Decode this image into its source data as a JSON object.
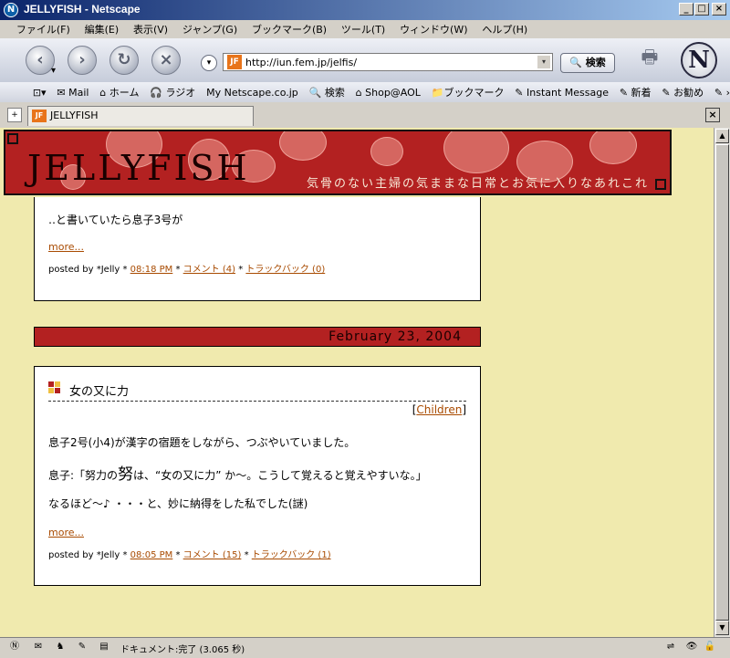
{
  "window": {
    "title": "JELLYFISH - Netscape",
    "app_icon": "netscape-icon",
    "min": "_",
    "max": "□",
    "close": "×"
  },
  "menu": [
    "ファイル(F)",
    "編集(E)",
    "表示(V)",
    "ジャンプ(G)",
    "ブックマーク(B)",
    "ツール(T)",
    "ウィンドウ(W)",
    "ヘルプ(H)"
  ],
  "nav": {
    "back": "‹",
    "forward": "›",
    "reload": "↻",
    "stop": "×",
    "dropdown": "▾",
    "url": "http://iun.fem.jp/jelfis/",
    "search_label": "🔍 検索",
    "logo": "N"
  },
  "personal_toolbar": [
    "⊡▾",
    "✉ Mail",
    "⌂ ホーム",
    "🎧 ラジオ",
    "My Netscape.co.jp",
    "🔍 検索",
    "⌂ Shop@AOL",
    "📁ブックマーク",
    "✎ Instant Message",
    "✎ 新着",
    "✎ お勧め",
    "✎ ›"
  ],
  "tab": {
    "favicon": "JF",
    "label": "JELLYFISH",
    "close": "×"
  },
  "banner": {
    "title": "JELLYFISH",
    "tagline": "気骨のない主婦の気ままな日常とお気に入りなあれこれ"
  },
  "post1": {
    "text": "‥と書いていたら息子3号が",
    "more": "more...",
    "meta_prefix": "posted by *Jelly * ",
    "time": "08:18 PM",
    "sep1": " * ",
    "comments": "コメント (4)",
    "sep2": " * ",
    "trackback": "トラックバック (0)"
  },
  "date_header": "February 23, 2004",
  "post2": {
    "title": "女の又に力",
    "category_open": "[",
    "category": "Children",
    "category_close": "]",
    "p1": "息子2号(小4)が漢字の宿題をしながら、つぶやいていました。",
    "p2_prefix": "息子:「努力の",
    "p2_big": "努",
    "p2_suffix": "は、“女の又に力” か〜。こうして覚えると覚えやすいな。」",
    "p3": "なるほど〜♪ ・・・と、妙に納得をした私でした(謎)",
    "more": "more...",
    "meta_prefix": "posted by *Jelly * ",
    "time": "08:05 PM",
    "sep1": " * ",
    "comments": "コメント (15)",
    "sep2": " * ",
    "trackback": "トラックバック (1)"
  },
  "scrollbar": {
    "up": "▲",
    "down": "▼"
  },
  "status": {
    "text": "ドキュメント:完了 (3.065 秒)"
  },
  "colors": {
    "accent": "#b32121",
    "page_bg": "#f0eaae",
    "link": "#a84a00"
  }
}
